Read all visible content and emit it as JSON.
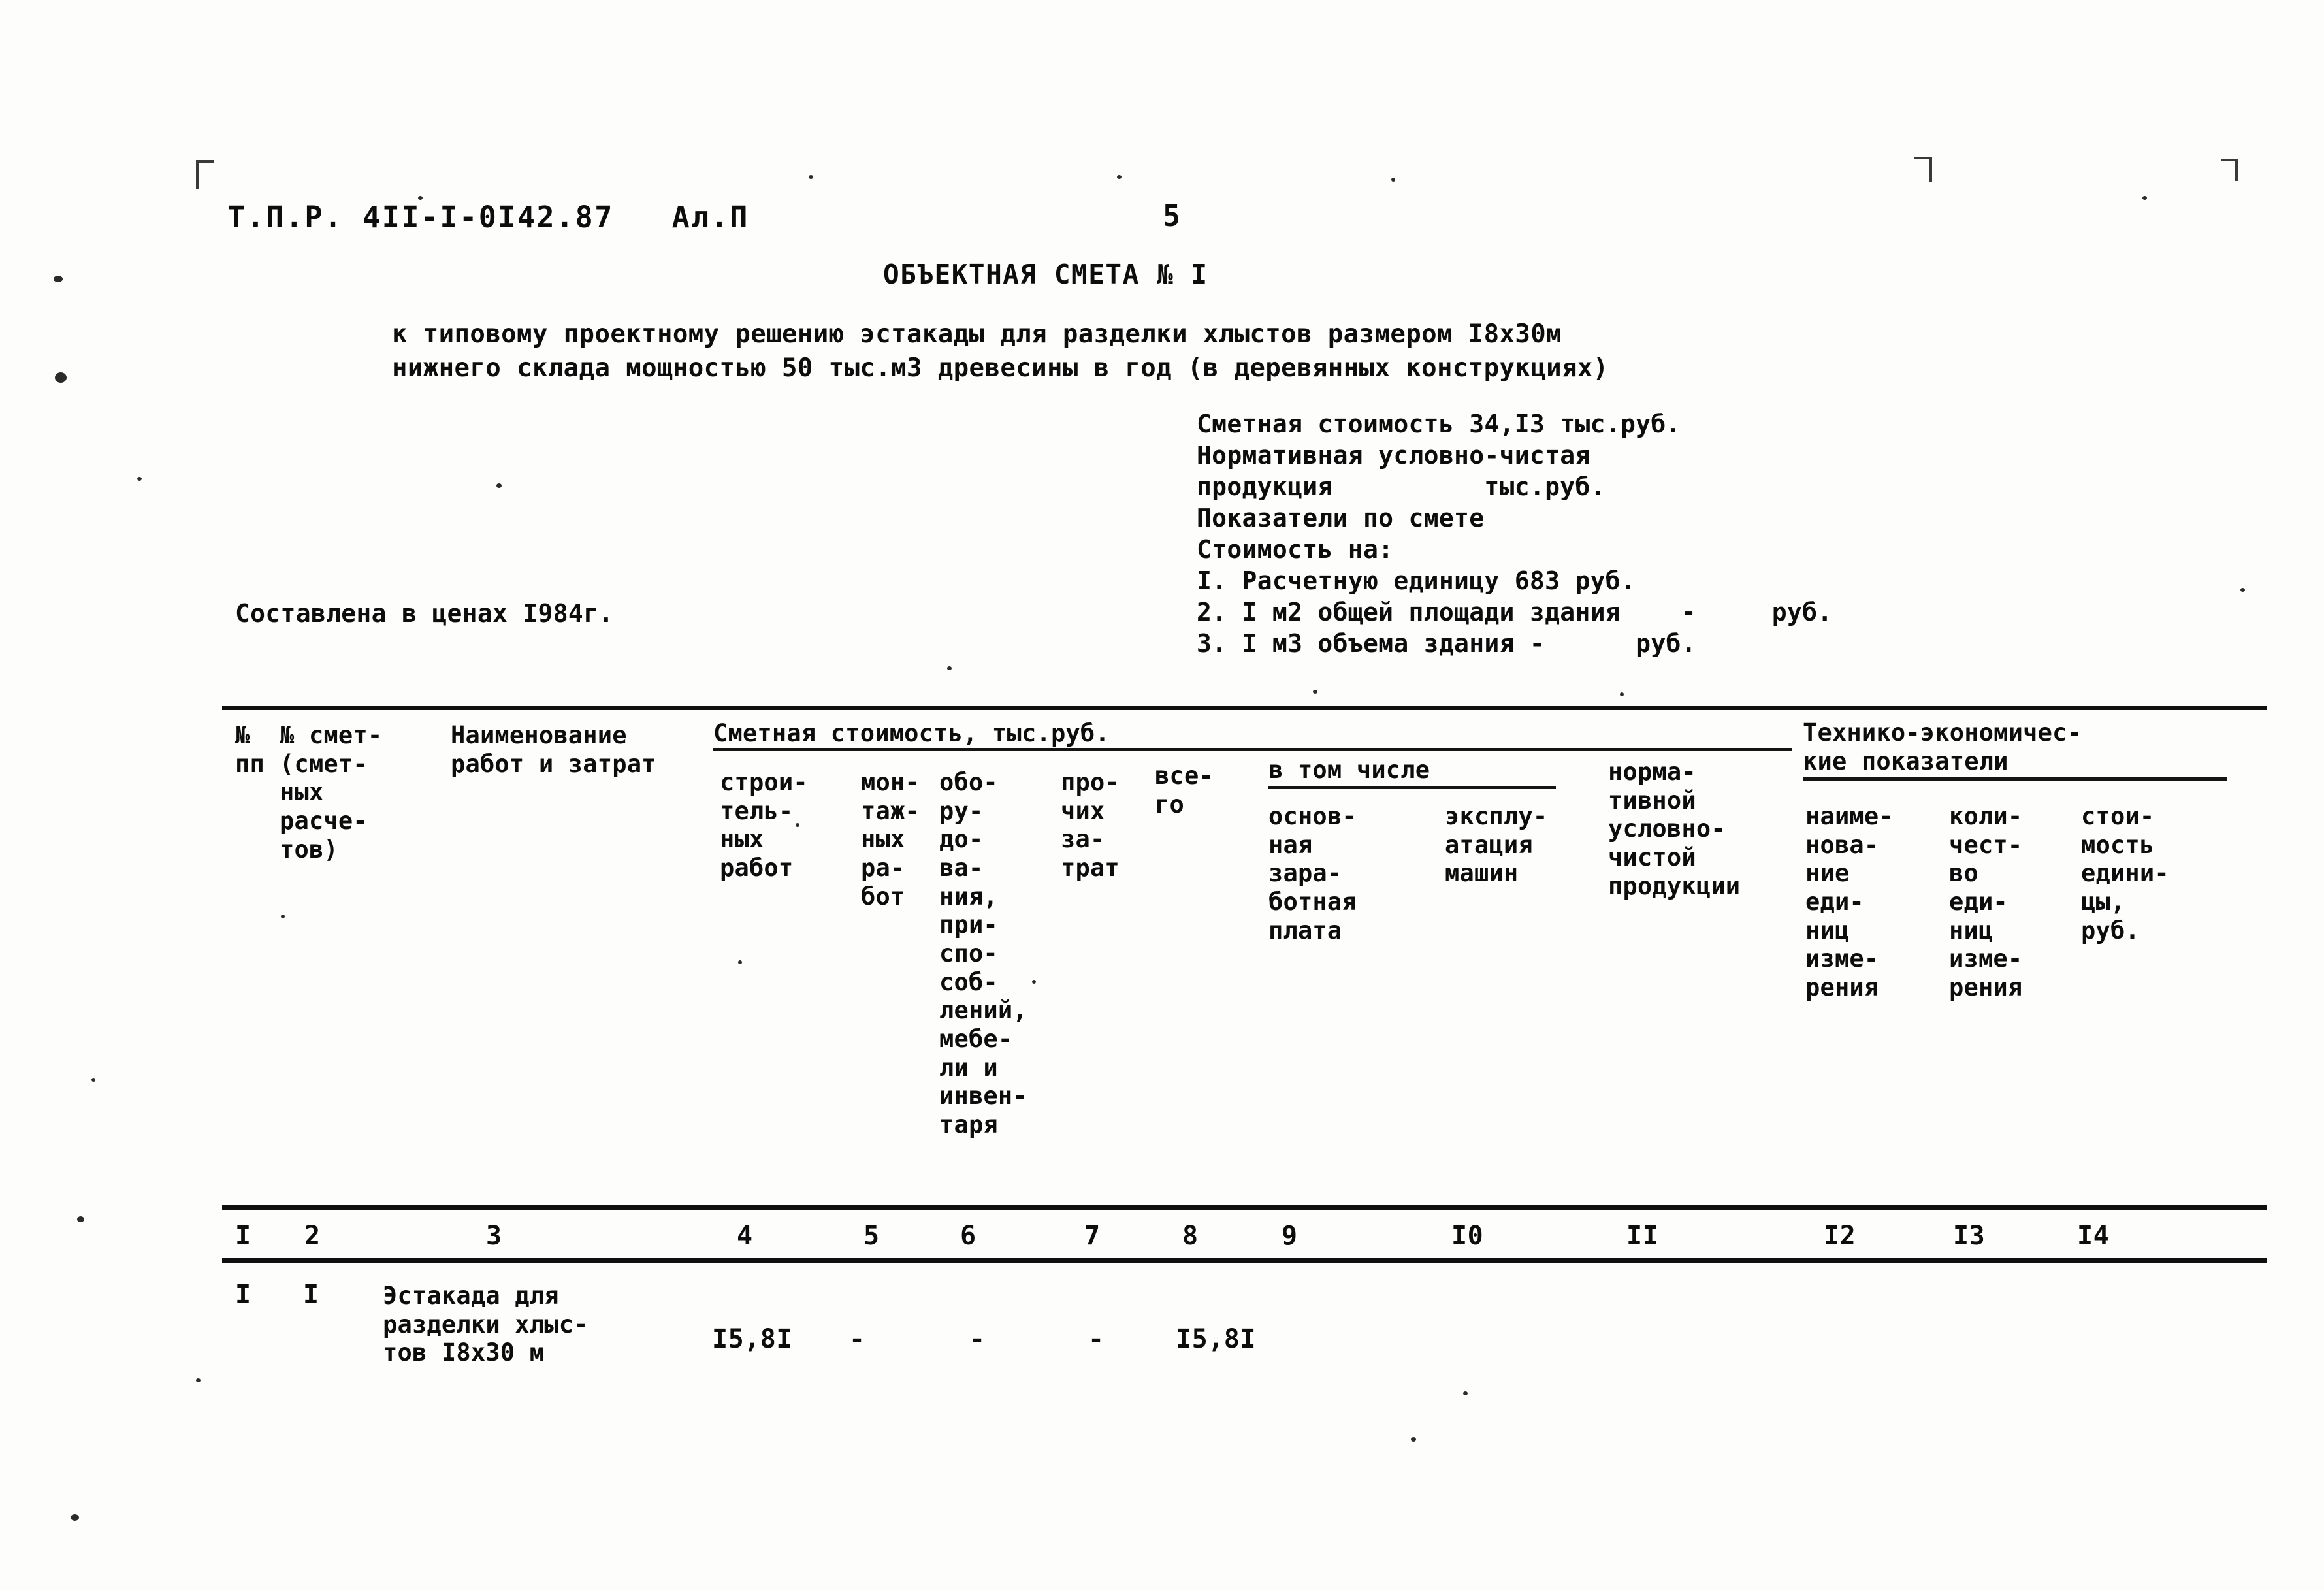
{
  "page": {
    "doc_code": "Т.П.Р. 4II-I-0I42.87   Ал.П",
    "page_number": "5",
    "title": "ОБЪЕКТНАЯ СМЕТА № I",
    "subtitle_line1": "к типовому проектному решению эстакады для разделки хлыстов размером I8х30м",
    "subtitle_line2": "нижнего склада мощностью 50 тыс.м3 древесины в год (в деревянных конструкциях)",
    "prices_note": "Составлена в ценах I984г."
  },
  "summary": {
    "line1": "Сметная стоимость 34,I3 тыс.руб.",
    "line2": "Нормативная условно-чистая",
    "line3": "продукция          тыс.руб.",
    "line4": "Показатели по смете",
    "line5": "Стоимость на:",
    "line6": "I. Расчетную единицу 683 руб.",
    "line7": "2. I м2 общей площади здания    -     руб.",
    "line8": "3. I м3 объема здания -      руб."
  },
  "table": {
    "group_headers": {
      "smetnaya_stoimost": "Сметная стоимость, тыс.руб.",
      "v_tom_chisle": "в том числе",
      "tech_econ": {
        "line1": "Технико-экономичес-",
        "line2": "кие показатели"
      }
    },
    "columns": [
      {
        "num": "I",
        "caption_lines": [
          "№",
          "пп"
        ]
      },
      {
        "num": "2",
        "caption_lines": [
          "№ смет-",
          "(смет-",
          "ных",
          "расче-",
          "тов)"
        ]
      },
      {
        "num": "3",
        "caption_lines": [
          "Наименование",
          "работ и затрат"
        ]
      },
      {
        "num": "4",
        "caption_lines": [
          "строи-",
          "тель-",
          "ных",
          "работ"
        ]
      },
      {
        "num": "5",
        "caption_lines": [
          "мон-",
          "таж-",
          "ных",
          "ра-",
          "бот"
        ]
      },
      {
        "num": "6",
        "caption_lines": [
          "обо-",
          "ру-",
          "до-",
          "ва-",
          "ния,",
          "при-",
          "спо-",
          "соб-",
          "лений,",
          "мебе-",
          "ли и",
          "инвен-",
          "таря"
        ]
      },
      {
        "num": "7",
        "caption_lines": [
          "про-",
          "чих",
          "за-",
          "трат"
        ]
      },
      {
        "num": "8",
        "caption_lines": [
          "все-",
          "го"
        ]
      },
      {
        "num": "9",
        "caption_lines": [
          "основ-",
          "ная",
          "зара-",
          "ботная",
          "плата"
        ]
      },
      {
        "num": "I0",
        "caption_lines": [
          "эксплу-",
          "атация",
          "машин"
        ]
      },
      {
        "num": "II",
        "caption_lines": [
          "норма-",
          "тивной",
          "условно-",
          "чистой",
          "продукции"
        ]
      },
      {
        "num": "I2",
        "caption_lines": [
          "наиме-",
          "нова-",
          "ние",
          "еди-",
          "ниц",
          "изме-",
          "рения"
        ]
      },
      {
        "num": "I3",
        "caption_lines": [
          "коли-",
          "чест-",
          "во",
          "еди-",
          "ниц",
          "изме-",
          "рения"
        ]
      },
      {
        "num": "I4",
        "caption_lines": [
          "стои-",
          "мость",
          "едини-",
          "цы,",
          "руб."
        ]
      }
    ],
    "numbers_row": [
      "I",
      "2",
      "3",
      "4",
      "5",
      "6",
      "7",
      "8",
      "9",
      "I0",
      "II",
      "I2",
      "I3",
      "I4"
    ],
    "rows": [
      {
        "c1": "I",
        "c2": "I",
        "c3_lines": [
          "Эстакада для",
          "разделки хлыс-",
          "тов I8х30 м"
        ],
        "c4": "I5,8I",
        "c5": "-",
        "c6": "-",
        "c7": "-",
        "c8": "I5,8I",
        "c9": "",
        "c10": "",
        "c11": "",
        "c12": "",
        "c13": "",
        "c14": ""
      }
    ]
  },
  "colors": {
    "ink": "#0d0d0d",
    "paper": "#fdfdfc",
    "faded_ink": "#8f8f8f"
  }
}
